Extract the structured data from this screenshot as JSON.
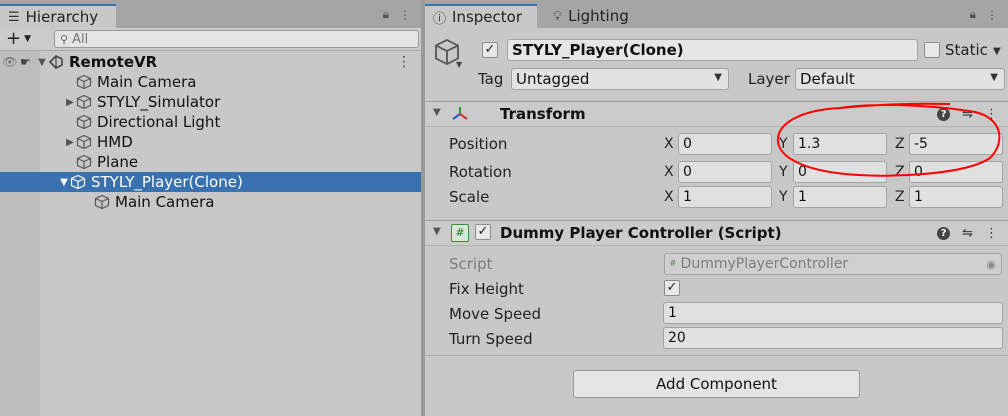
{
  "hierarchy": {
    "tab_label": "Hierarchy",
    "search_placeholder": "All",
    "add_label": "+",
    "scene": "RemoteVR",
    "items": [
      {
        "label": "Main Camera",
        "foldout": false
      },
      {
        "label": "STYLY_Simulator",
        "foldout": true
      },
      {
        "label": "Directional Light",
        "foldout": false
      },
      {
        "label": "HMD",
        "foldout": true
      },
      {
        "label": "Plane",
        "foldout": false
      },
      {
        "label": "STYLY_Player(Clone)",
        "foldout": true,
        "selected": true
      },
      {
        "label": "Main Camera",
        "foldout": false,
        "child": true
      }
    ]
  },
  "inspector": {
    "tabs": [
      "Inspector",
      "Lighting"
    ],
    "object_name": "STYLY_Player(Clone)",
    "static_label": "Static",
    "tag_label": "Tag",
    "tag_value": "Untagged",
    "layer_label": "Layer",
    "layer_value": "Default",
    "transform": {
      "title": "Transform",
      "position": {
        "label": "Position",
        "x": "0",
        "y": "1.3",
        "z": "-5"
      },
      "rotation": {
        "label": "Rotation",
        "x": "0",
        "y": "0",
        "z": "0"
      },
      "scale": {
        "label": "Scale",
        "x": "1",
        "y": "1",
        "z": "1"
      },
      "axes": {
        "x": "X",
        "y": "Y",
        "z": "Z"
      }
    },
    "script_component": {
      "title": "Dummy Player Controller (Script)",
      "script_label": "Script",
      "script_value": "DummyPlayerController",
      "fix_height_label": "Fix Height",
      "fix_height_checked": true,
      "move_speed_label": "Move Speed",
      "move_speed_value": "1",
      "turn_speed_label": "Turn Speed",
      "turn_speed_value": "20"
    },
    "add_component_label": "Add Component"
  },
  "colors": {
    "selection": "#3a72b0",
    "annotation": "#ff0000",
    "panel": "#c8c8c8"
  }
}
